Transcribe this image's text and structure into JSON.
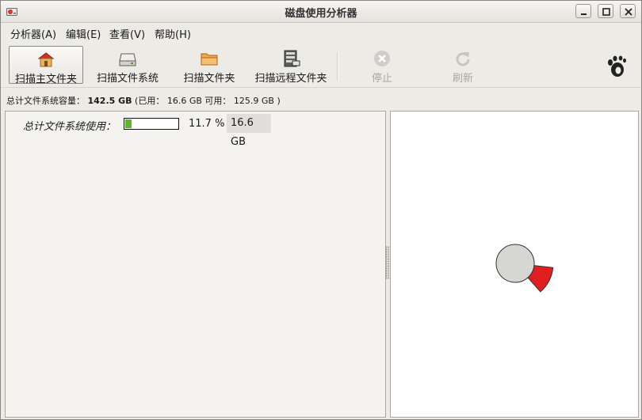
{
  "window": {
    "title": "磁盘使用分析器"
  },
  "menu": [
    {
      "label": "分析器(A)"
    },
    {
      "label": "编辑(E)"
    },
    {
      "label": "查看(V)"
    },
    {
      "label": "帮助(H)"
    }
  ],
  "toolbar": {
    "scan_home": "扫描主文件夹",
    "scan_filesystem": "扫描文件系统",
    "scan_folder": "扫描文件夹",
    "scan_remote": "扫描远程文件夹",
    "stop": "停止",
    "refresh": "刷新"
  },
  "capacity": {
    "label": "总计文件系统容量：",
    "total": "142.5 GB",
    "used_label": "(已用：",
    "used": "16.6 GB",
    "available_label": "可用：",
    "available": "125.9 GB",
    "close_paren": ")"
  },
  "usage": {
    "label": "总计文件系统使用：",
    "fraction": 0.117,
    "percent_text": "11.7 %",
    "size_text": "16.6 GB"
  },
  "colors": {
    "usage_bar": "#5cb82a",
    "ring_segment": "#e02020",
    "center_disc": "#d6d6d3"
  },
  "icons": [
    "disk-analyzer-app-icon",
    "minimize-icon",
    "maximize-icon",
    "close-icon",
    "home-folder-icon",
    "hard-drive-icon",
    "folder-icon",
    "remote-server-icon",
    "stop-icon",
    "refresh-icon",
    "gnome-foot-icon"
  ]
}
